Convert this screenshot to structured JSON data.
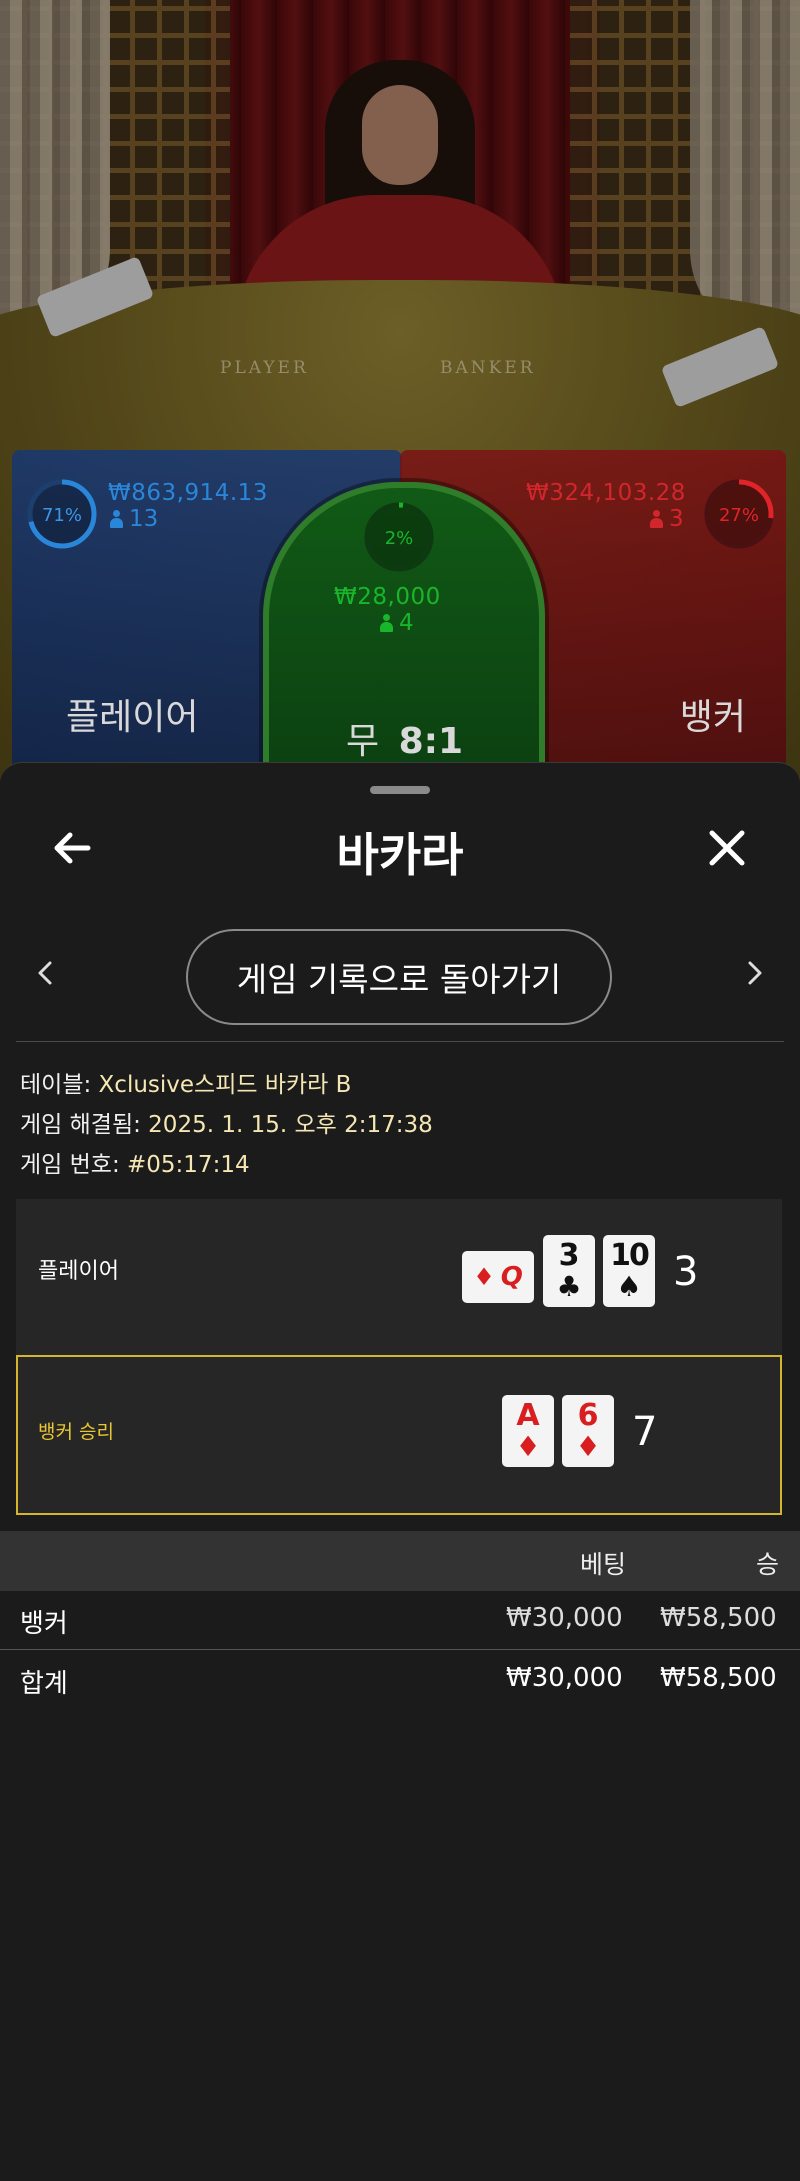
{
  "live": {
    "felt_player": "PLAYER",
    "felt_banker": "BANKER",
    "player": {
      "percent": "71%",
      "amount": "₩863,914.13",
      "count": "13",
      "label": "플레이어",
      "ring_fraction": 0.71
    },
    "tie": {
      "percent": "2%",
      "amount": "₩28,000",
      "count": "4",
      "label": "무",
      "payout": "8:1",
      "ring_fraction": 0.02
    },
    "banker": {
      "percent": "27%",
      "amount": "₩324,103.28",
      "count": "3",
      "label": "뱅커",
      "ring_fraction": 0.27
    },
    "colors": {
      "player": "#2a86d8",
      "tie": "#19b52a",
      "banker": "#e0242a"
    }
  },
  "sheet": {
    "title": "바카라",
    "history_button": "게임 기록으로 돌아가기",
    "table_key": "테이블: ",
    "table_value": "Xclusive스피드 바카라 B",
    "resolved_key": "게임 해결됨: ",
    "resolved_value": "2025. 1. 15. 오후 2:17:38",
    "round_key": "게임 번호: ",
    "round_value": "#05:17:14"
  },
  "result": {
    "player": {
      "label": "플레이어",
      "total": "3",
      "cards": [
        {
          "rank": "Q",
          "suit": "♦",
          "color": "red",
          "sideways": true
        },
        {
          "rank": "3",
          "suit": "♣",
          "color": "black"
        },
        {
          "rank": "10",
          "suit": "♠",
          "color": "black"
        }
      ]
    },
    "banker": {
      "label": "뱅커 승리",
      "total": "7",
      "cards": [
        {
          "rank": "A",
          "suit": "♦",
          "color": "red"
        },
        {
          "rank": "6",
          "suit": "♦",
          "color": "red"
        }
      ]
    },
    "win_color": "#d4b52c"
  },
  "bets": {
    "headers": {
      "bet": "베팅",
      "win": "승"
    },
    "rows": [
      {
        "name": "뱅커",
        "bet": "₩30,000",
        "win": "₩58,500"
      }
    ],
    "total": {
      "name": "합계",
      "bet": "₩30,000",
      "win": "₩58,500"
    }
  }
}
